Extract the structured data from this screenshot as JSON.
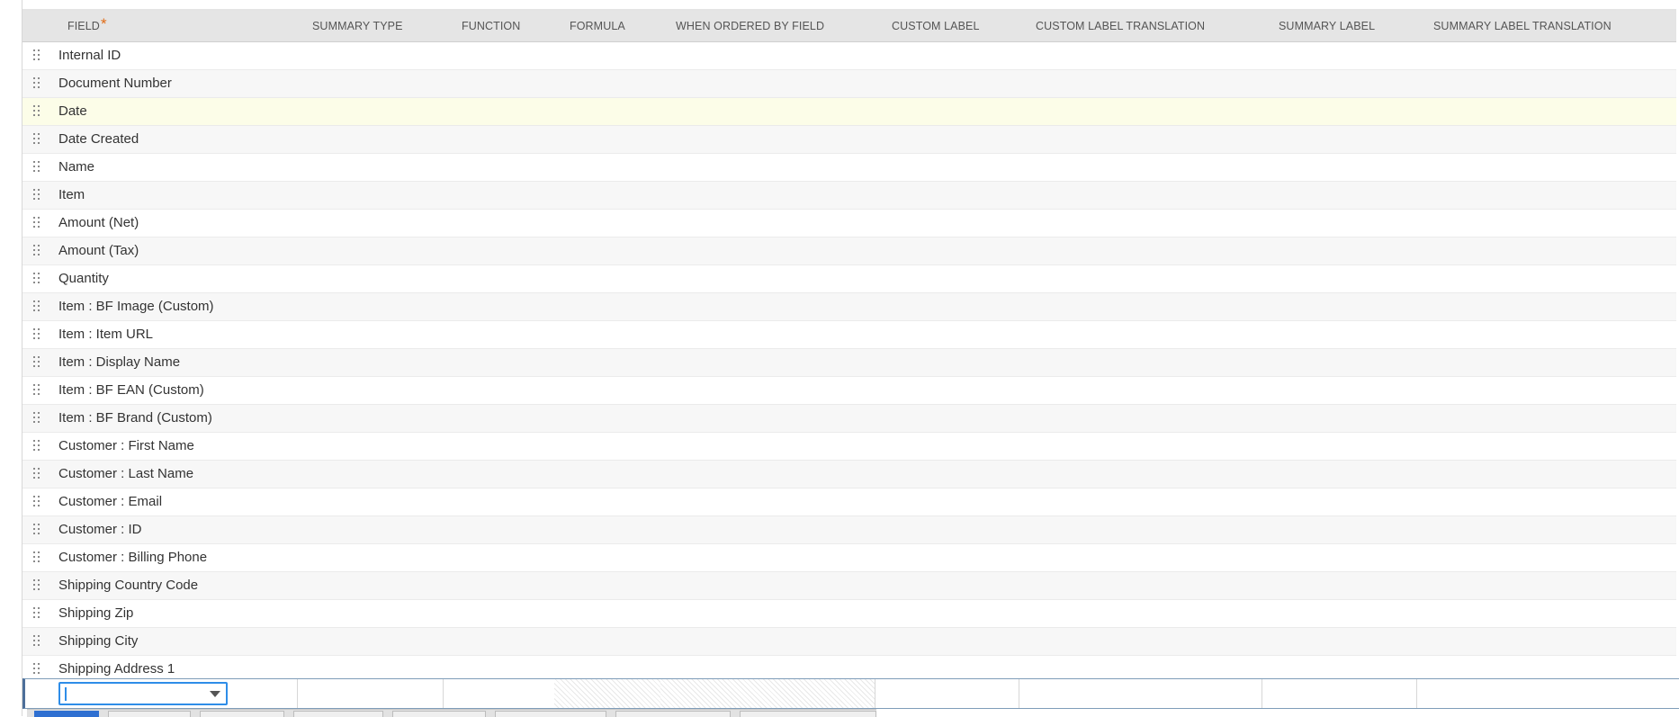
{
  "columns": {
    "field": "FIELD",
    "field_required_mark": "*",
    "summary_type": "SUMMARY TYPE",
    "function": "FUNCTION",
    "formula": "FORMULA",
    "when_ordered_by_field": "WHEN ORDERED BY FIELD",
    "custom_label": "CUSTOM LABEL",
    "custom_label_translation": "CUSTOM LABEL TRANSLATION",
    "summary_label": "SUMMARY LABEL",
    "summary_label_translation": "SUMMARY LABEL TRANSLATION"
  },
  "rows": [
    {
      "field": "Internal ID"
    },
    {
      "field": "Document Number"
    },
    {
      "field": "Date",
      "selected": true
    },
    {
      "field": "Date Created"
    },
    {
      "field": "Name"
    },
    {
      "field": "Item"
    },
    {
      "field": "Amount (Net)"
    },
    {
      "field": "Amount (Tax)"
    },
    {
      "field": "Quantity"
    },
    {
      "field": "Item : BF Image (Custom)"
    },
    {
      "field": "Item : Item URL"
    },
    {
      "field": "Item : Display Name"
    },
    {
      "field": "Item : BF EAN (Custom)"
    },
    {
      "field": "Item : BF Brand (Custom)"
    },
    {
      "field": "Customer : First Name"
    },
    {
      "field": "Customer : Last Name"
    },
    {
      "field": "Customer : Email"
    },
    {
      "field": "Customer : ID"
    },
    {
      "field": "Customer : Billing Phone"
    },
    {
      "field": "Shipping Country Code"
    },
    {
      "field": "Shipping Zip"
    },
    {
      "field": "Shipping City"
    },
    {
      "field": "Shipping Address 1"
    }
  ],
  "new_row": {
    "field_select_value": "",
    "field_select_icon": "chevron-down-icon"
  },
  "icons": {
    "row_handle": "drag-handle-icon"
  },
  "colors": {
    "header_bg": "#e5e5e5",
    "selected_row_bg": "#fcfde8",
    "required_mark": "#e06b15",
    "focus_border": "#2e8de8"
  }
}
